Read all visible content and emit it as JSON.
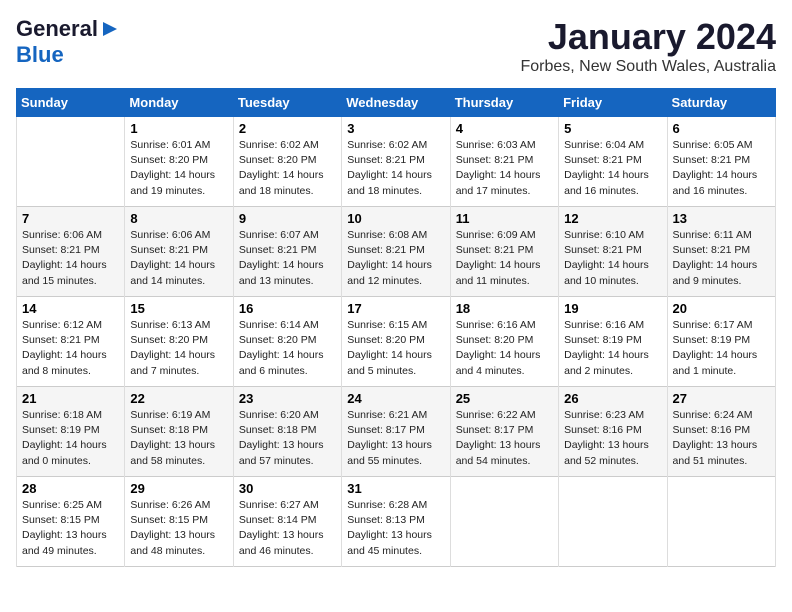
{
  "header": {
    "logo_general": "General",
    "logo_blue": "Blue",
    "month": "January 2024",
    "location": "Forbes, New South Wales, Australia"
  },
  "calendar": {
    "days_of_week": [
      "Sunday",
      "Monday",
      "Tuesday",
      "Wednesday",
      "Thursday",
      "Friday",
      "Saturday"
    ],
    "weeks": [
      [
        {
          "day": "",
          "info": ""
        },
        {
          "day": "1",
          "info": "Sunrise: 6:01 AM\nSunset: 8:20 PM\nDaylight: 14 hours\nand 19 minutes."
        },
        {
          "day": "2",
          "info": "Sunrise: 6:02 AM\nSunset: 8:20 PM\nDaylight: 14 hours\nand 18 minutes."
        },
        {
          "day": "3",
          "info": "Sunrise: 6:02 AM\nSunset: 8:21 PM\nDaylight: 14 hours\nand 18 minutes."
        },
        {
          "day": "4",
          "info": "Sunrise: 6:03 AM\nSunset: 8:21 PM\nDaylight: 14 hours\nand 17 minutes."
        },
        {
          "day": "5",
          "info": "Sunrise: 6:04 AM\nSunset: 8:21 PM\nDaylight: 14 hours\nand 16 minutes."
        },
        {
          "day": "6",
          "info": "Sunrise: 6:05 AM\nSunset: 8:21 PM\nDaylight: 14 hours\nand 16 minutes."
        }
      ],
      [
        {
          "day": "7",
          "info": "Sunrise: 6:06 AM\nSunset: 8:21 PM\nDaylight: 14 hours\nand 15 minutes."
        },
        {
          "day": "8",
          "info": "Sunrise: 6:06 AM\nSunset: 8:21 PM\nDaylight: 14 hours\nand 14 minutes."
        },
        {
          "day": "9",
          "info": "Sunrise: 6:07 AM\nSunset: 8:21 PM\nDaylight: 14 hours\nand 13 minutes."
        },
        {
          "day": "10",
          "info": "Sunrise: 6:08 AM\nSunset: 8:21 PM\nDaylight: 14 hours\nand 12 minutes."
        },
        {
          "day": "11",
          "info": "Sunrise: 6:09 AM\nSunset: 8:21 PM\nDaylight: 14 hours\nand 11 minutes."
        },
        {
          "day": "12",
          "info": "Sunrise: 6:10 AM\nSunset: 8:21 PM\nDaylight: 14 hours\nand 10 minutes."
        },
        {
          "day": "13",
          "info": "Sunrise: 6:11 AM\nSunset: 8:21 PM\nDaylight: 14 hours\nand 9 minutes."
        }
      ],
      [
        {
          "day": "14",
          "info": "Sunrise: 6:12 AM\nSunset: 8:21 PM\nDaylight: 14 hours\nand 8 minutes."
        },
        {
          "day": "15",
          "info": "Sunrise: 6:13 AM\nSunset: 8:20 PM\nDaylight: 14 hours\nand 7 minutes."
        },
        {
          "day": "16",
          "info": "Sunrise: 6:14 AM\nSunset: 8:20 PM\nDaylight: 14 hours\nand 6 minutes."
        },
        {
          "day": "17",
          "info": "Sunrise: 6:15 AM\nSunset: 8:20 PM\nDaylight: 14 hours\nand 5 minutes."
        },
        {
          "day": "18",
          "info": "Sunrise: 6:16 AM\nSunset: 8:20 PM\nDaylight: 14 hours\nand 4 minutes."
        },
        {
          "day": "19",
          "info": "Sunrise: 6:16 AM\nSunset: 8:19 PM\nDaylight: 14 hours\nand 2 minutes."
        },
        {
          "day": "20",
          "info": "Sunrise: 6:17 AM\nSunset: 8:19 PM\nDaylight: 14 hours\nand 1 minute."
        }
      ],
      [
        {
          "day": "21",
          "info": "Sunrise: 6:18 AM\nSunset: 8:19 PM\nDaylight: 14 hours\nand 0 minutes."
        },
        {
          "day": "22",
          "info": "Sunrise: 6:19 AM\nSunset: 8:18 PM\nDaylight: 13 hours\nand 58 minutes."
        },
        {
          "day": "23",
          "info": "Sunrise: 6:20 AM\nSunset: 8:18 PM\nDaylight: 13 hours\nand 57 minutes."
        },
        {
          "day": "24",
          "info": "Sunrise: 6:21 AM\nSunset: 8:17 PM\nDaylight: 13 hours\nand 55 minutes."
        },
        {
          "day": "25",
          "info": "Sunrise: 6:22 AM\nSunset: 8:17 PM\nDaylight: 13 hours\nand 54 minutes."
        },
        {
          "day": "26",
          "info": "Sunrise: 6:23 AM\nSunset: 8:16 PM\nDaylight: 13 hours\nand 52 minutes."
        },
        {
          "day": "27",
          "info": "Sunrise: 6:24 AM\nSunset: 8:16 PM\nDaylight: 13 hours\nand 51 minutes."
        }
      ],
      [
        {
          "day": "28",
          "info": "Sunrise: 6:25 AM\nSunset: 8:15 PM\nDaylight: 13 hours\nand 49 minutes."
        },
        {
          "day": "29",
          "info": "Sunrise: 6:26 AM\nSunset: 8:15 PM\nDaylight: 13 hours\nand 48 minutes."
        },
        {
          "day": "30",
          "info": "Sunrise: 6:27 AM\nSunset: 8:14 PM\nDaylight: 13 hours\nand 46 minutes."
        },
        {
          "day": "31",
          "info": "Sunrise: 6:28 AM\nSunset: 8:13 PM\nDaylight: 13 hours\nand 45 minutes."
        },
        {
          "day": "",
          "info": ""
        },
        {
          "day": "",
          "info": ""
        },
        {
          "day": "",
          "info": ""
        }
      ]
    ]
  }
}
